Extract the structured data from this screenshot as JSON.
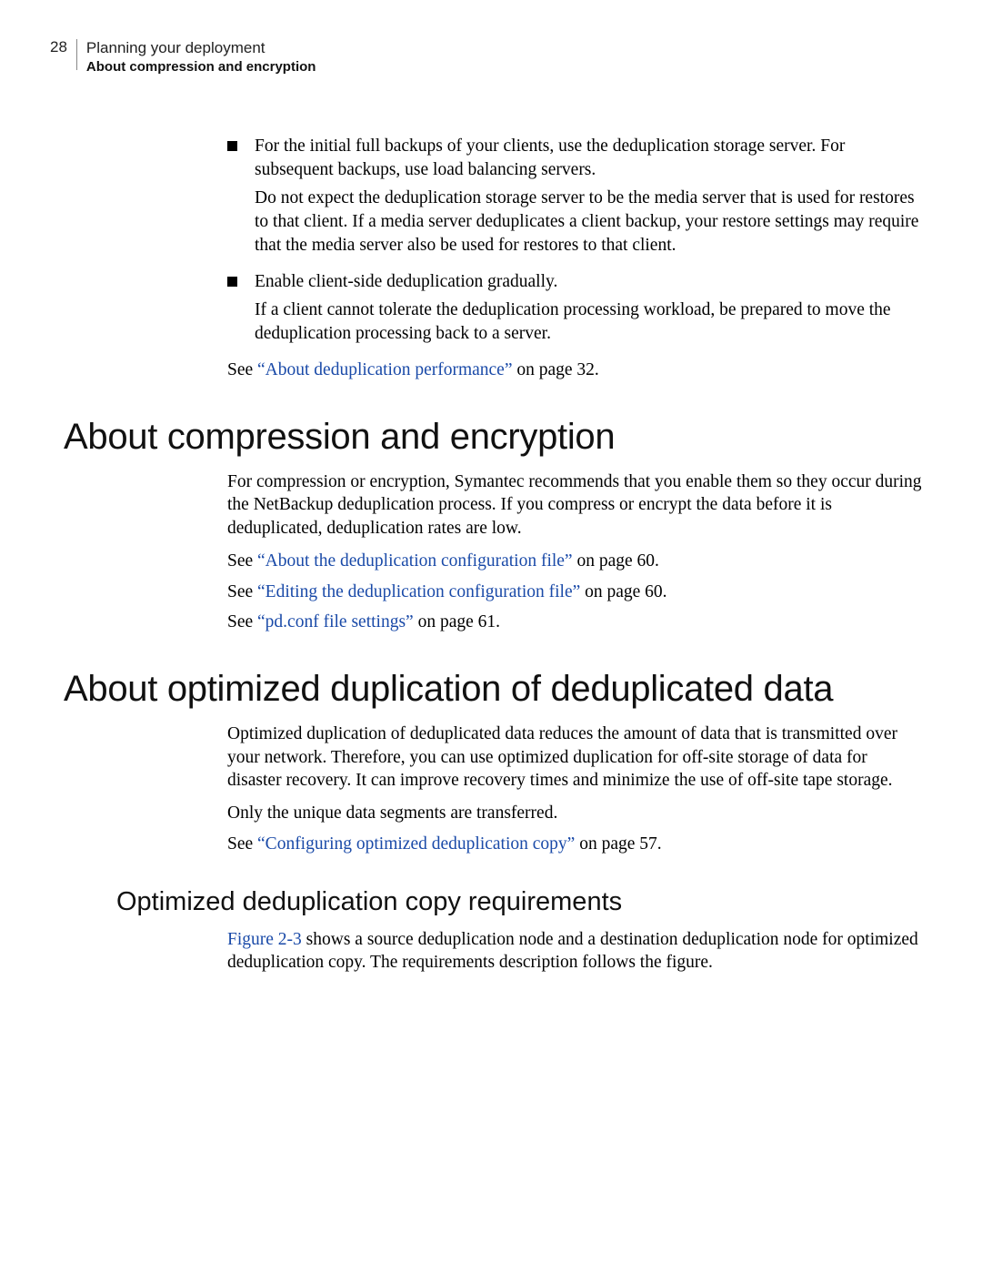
{
  "header": {
    "page_number": "28",
    "line1": "Planning your deployment",
    "line2": "About compression and encryption"
  },
  "bullets": {
    "item0": {
      "p0": "For the initial full backups of your clients, use the deduplication storage server. For subsequent backups, use load balancing servers.",
      "p1": "Do not expect the deduplication storage server to be the media server that is used for restores to that client. If a media server deduplicates a client backup, your restore settings may require that the media server also be used for restores to that client."
    },
    "item1": {
      "p0": "Enable client-side deduplication gradually.",
      "p1": "If a client cannot tolerate the deduplication processing workload, be prepared to move the deduplication processing back to a server."
    }
  },
  "see_performance": {
    "prefix": "See ",
    "link": "“About deduplication performance”",
    "suffix": " on page 32."
  },
  "section_compression": {
    "title": "About compression and encryption",
    "p0": "For compression or encryption, Symantec recommends that you enable them so they occur during the NetBackup deduplication process. If you compress or encrypt the data before it is deduplicated, deduplication rates are low.",
    "see0": {
      "prefix": "See ",
      "link": "“About the deduplication configuration file”",
      "suffix": " on page 60."
    },
    "see1": {
      "prefix": "See ",
      "link": "“Editing the deduplication configuration file”",
      "suffix": " on page 60."
    },
    "see2": {
      "prefix": "See ",
      "link": "“pd.conf file settings”",
      "suffix": " on page 61."
    }
  },
  "section_optimized": {
    "title": "About optimized duplication of deduplicated data",
    "p0": "Optimized duplication of deduplicated data reduces the amount of data that is transmitted over your network. Therefore, you can use optimized duplication for off-site storage of data for disaster recovery. It can improve recovery times and minimize the use of off-site tape storage.",
    "p1": "Only the unique data segments are transferred.",
    "see0": {
      "prefix": "See ",
      "link": "“Configuring optimized deduplication copy”",
      "suffix": " on page 57."
    }
  },
  "subsection_reqs": {
    "title": "Optimized deduplication copy requirements",
    "p0_link": "Figure 2-3",
    "p0_rest": " shows a source deduplication node and a destination deduplication node for optimized deduplication copy. The requirements description follows the figure."
  }
}
